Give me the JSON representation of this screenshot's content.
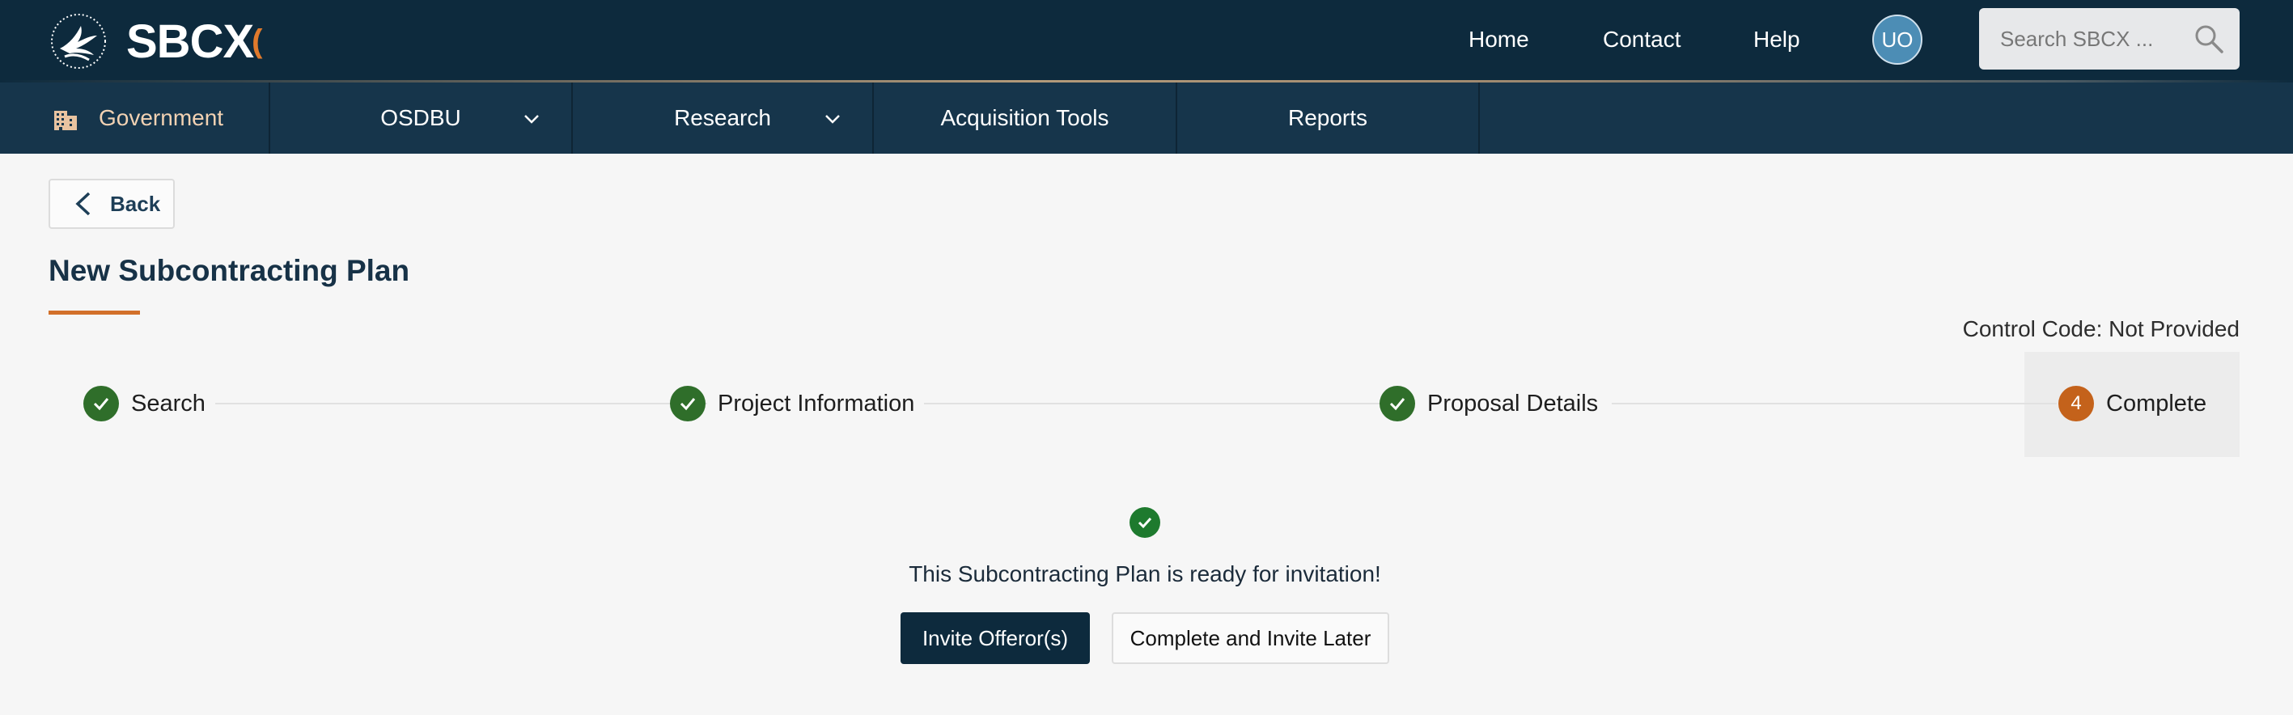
{
  "brand": {
    "name": "SBCX",
    "logo_icon": "hhs-eagle-icon",
    "accent_color": "#e07a2c"
  },
  "header": {
    "nav": [
      {
        "label": "Home"
      },
      {
        "label": "Contact"
      },
      {
        "label": "Help"
      }
    ],
    "avatar_initials": "UO",
    "search": {
      "placeholder": "Search SBCX ...",
      "icon": "search-icon"
    }
  },
  "subnav": {
    "portal_label": "Government",
    "portal_icon": "building-icon",
    "items": [
      {
        "label": "OSDBU",
        "has_dropdown": true
      },
      {
        "label": "Research",
        "has_dropdown": true
      },
      {
        "label": "Acquisition Tools",
        "has_dropdown": false
      },
      {
        "label": "Reports",
        "has_dropdown": false
      }
    ]
  },
  "page": {
    "back_label": "Back",
    "title": "New Subcontracting Plan",
    "control_code": "Control Code: Not Provided"
  },
  "stepper": {
    "steps": [
      {
        "label": "Search",
        "status": "done"
      },
      {
        "label": "Project Information",
        "status": "done"
      },
      {
        "label": "Proposal Details",
        "status": "done"
      },
      {
        "label": "Complete",
        "status": "current",
        "number": "4"
      }
    ]
  },
  "result": {
    "message": "This Subcontracting Plan is ready for invitation!",
    "primary_action": "Invite Offeror(s)",
    "secondary_action": "Complete and Invite Later"
  },
  "colors": {
    "header_bg": "#0d2a3d",
    "subnav_bg": "#16354b",
    "step_done": "#2f6e2a",
    "step_current": "#c4621b",
    "title_underline": "#d2702a"
  }
}
